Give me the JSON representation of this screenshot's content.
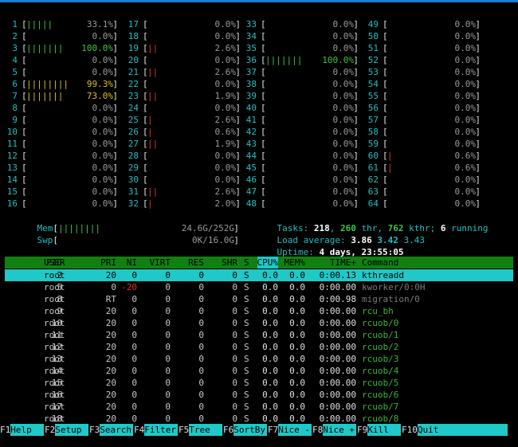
{
  "cpus": [
    {
      "n": "1",
      "pct": "33.1%",
      "bars": "|||||",
      "color": "g"
    },
    {
      "n": "2",
      "pct": "0.0%",
      "bars": "",
      "color": "g"
    },
    {
      "n": "3",
      "pct": "100.0%",
      "bars": "|||||||",
      "color": "g"
    },
    {
      "n": "4",
      "pct": "0.0%",
      "bars": "",
      "color": "g"
    },
    {
      "n": "5",
      "pct": "0.0%",
      "bars": "",
      "color": "g"
    },
    {
      "n": "6",
      "pct": "99.3%",
      "bars": "||||||||",
      "color": "y"
    },
    {
      "n": "7",
      "pct": "73.0%",
      "bars": "|||||||",
      "color": "y"
    },
    {
      "n": "8",
      "pct": "0.0%",
      "bars": "",
      "color": "g"
    },
    {
      "n": "9",
      "pct": "0.0%",
      "bars": "",
      "color": "g"
    },
    {
      "n": "10",
      "pct": "0.0%",
      "bars": "",
      "color": "g"
    },
    {
      "n": "11",
      "pct": "0.0%",
      "bars": "",
      "color": "g"
    },
    {
      "n": "12",
      "pct": "0.0%",
      "bars": "",
      "color": "g"
    },
    {
      "n": "13",
      "pct": "0.0%",
      "bars": "",
      "color": "g"
    },
    {
      "n": "14",
      "pct": "0.0%",
      "bars": "",
      "color": "g"
    },
    {
      "n": "15",
      "pct": "0.0%",
      "bars": "",
      "color": "g"
    },
    {
      "n": "16",
      "pct": "0.0%",
      "bars": "",
      "color": "g"
    },
    {
      "n": "17",
      "pct": "0.0%",
      "bars": "",
      "color": "g"
    },
    {
      "n": "18",
      "pct": "0.0%",
      "bars": "",
      "color": "g"
    },
    {
      "n": "19",
      "pct": "2.6%",
      "bars": "||",
      "color": "r"
    },
    {
      "n": "20",
      "pct": "0.0%",
      "bars": "",
      "color": "g"
    },
    {
      "n": "21",
      "pct": "2.6%",
      "bars": "||",
      "color": "r"
    },
    {
      "n": "22",
      "pct": "0.0%",
      "bars": "",
      "color": "g"
    },
    {
      "n": "23",
      "pct": "1.9%",
      "bars": "||",
      "color": "r"
    },
    {
      "n": "24",
      "pct": "0.0%",
      "bars": "",
      "color": "g"
    },
    {
      "n": "25",
      "pct": "2.6%",
      "bars": "|",
      "color": "r"
    },
    {
      "n": "26",
      "pct": "0.6%",
      "bars": "|",
      "color": "r"
    },
    {
      "n": "27",
      "pct": "1.9%",
      "bars": "||",
      "color": "r"
    },
    {
      "n": "28",
      "pct": "0.0%",
      "bars": "",
      "color": "g"
    },
    {
      "n": "29",
      "pct": "0.0%",
      "bars": "",
      "color": "g"
    },
    {
      "n": "30",
      "pct": "0.0%",
      "bars": "",
      "color": "g"
    },
    {
      "n": "31",
      "pct": "2.6%",
      "bars": "||",
      "color": "r"
    },
    {
      "n": "32",
      "pct": "2.0%",
      "bars": "|",
      "color": "r"
    },
    {
      "n": "33",
      "pct": "0.0%",
      "bars": "",
      "color": "g"
    },
    {
      "n": "34",
      "pct": "0.0%",
      "bars": "",
      "color": "g"
    },
    {
      "n": "35",
      "pct": "0.0%",
      "bars": "",
      "color": "g"
    },
    {
      "n": "36",
      "pct": "100.0%",
      "bars": "|||||||",
      "color": "g"
    },
    {
      "n": "37",
      "pct": "0.0%",
      "bars": "",
      "color": "g"
    },
    {
      "n": "38",
      "pct": "0.0%",
      "bars": "",
      "color": "g"
    },
    {
      "n": "39",
      "pct": "0.0%",
      "bars": "",
      "color": "g"
    },
    {
      "n": "40",
      "pct": "0.0%",
      "bars": "",
      "color": "g"
    },
    {
      "n": "41",
      "pct": "0.0%",
      "bars": "",
      "color": "g"
    },
    {
      "n": "42",
      "pct": "0.0%",
      "bars": "",
      "color": "g"
    },
    {
      "n": "43",
      "pct": "0.0%",
      "bars": "",
      "color": "g"
    },
    {
      "n": "44",
      "pct": "0.0%",
      "bars": "",
      "color": "g"
    },
    {
      "n": "45",
      "pct": "0.0%",
      "bars": "",
      "color": "g"
    },
    {
      "n": "46",
      "pct": "0.0%",
      "bars": "",
      "color": "g"
    },
    {
      "n": "47",
      "pct": "0.0%",
      "bars": "",
      "color": "g"
    },
    {
      "n": "48",
      "pct": "0.0%",
      "bars": "",
      "color": "g"
    },
    {
      "n": "49",
      "pct": "0.0%",
      "bars": "",
      "color": "g"
    },
    {
      "n": "50",
      "pct": "0.0%",
      "bars": "",
      "color": "g"
    },
    {
      "n": "51",
      "pct": "0.0%",
      "bars": "",
      "color": "g"
    },
    {
      "n": "52",
      "pct": "0.0%",
      "bars": "",
      "color": "g"
    },
    {
      "n": "53",
      "pct": "0.0%",
      "bars": "",
      "color": "g"
    },
    {
      "n": "54",
      "pct": "0.0%",
      "bars": "",
      "color": "g"
    },
    {
      "n": "55",
      "pct": "0.0%",
      "bars": "",
      "color": "g"
    },
    {
      "n": "56",
      "pct": "0.0%",
      "bars": "",
      "color": "g"
    },
    {
      "n": "57",
      "pct": "0.0%",
      "bars": "",
      "color": "g"
    },
    {
      "n": "58",
      "pct": "0.0%",
      "bars": "",
      "color": "g"
    },
    {
      "n": "59",
      "pct": "0.0%",
      "bars": "",
      "color": "g"
    },
    {
      "n": "60",
      "pct": "0.6%",
      "bars": "|",
      "color": "r"
    },
    {
      "n": "61",
      "pct": "0.6%",
      "bars": "|",
      "color": "r"
    },
    {
      "n": "62",
      "pct": "0.0%",
      "bars": "",
      "color": "g"
    },
    {
      "n": "63",
      "pct": "0.0%",
      "bars": "",
      "color": "g"
    },
    {
      "n": "64",
      "pct": "0.0%",
      "bars": "",
      "color": "g"
    }
  ],
  "memory": {
    "mem_label": "Mem",
    "mem_bars": "||||||||",
    "mem_value": "24.6G/252G",
    "swp_label": "Swp",
    "swp_value": "0K/16.0G"
  },
  "tasks": {
    "label": "Tasks:",
    "count": "218",
    "thr": "260",
    "thr_label": "thr,",
    "kthr": "762",
    "kthr_label": "kthr;",
    "running": "6",
    "running_label": "running",
    "load_label": "Load average:",
    "load1": "3.86",
    "load5": "3.42",
    "load15": "3.43",
    "uptime_label": "Uptime:",
    "uptime": "4 days, 23:55:05"
  },
  "columns": [
    "PID",
    "USER",
    "PRI",
    "NI",
    "VIRT",
    "RES",
    "SHR",
    "S",
    "CPU%",
    "MEM%",
    "TIME+",
    "Command"
  ],
  "processes": [
    {
      "pid": "2",
      "user": "root",
      "pri": "20",
      "ni": "0",
      "virt": "0",
      "res": "0",
      "shr": "0",
      "s": "S",
      "cpu": "0.0",
      "mem": "0.0",
      "time": "0:00.13",
      "cmd": "kthreadd"
    },
    {
      "pid": "5",
      "user": "root",
      "pri": "0",
      "ni": "-20",
      "virt": "0",
      "res": "0",
      "shr": "0",
      "s": "S",
      "cpu": "0.0",
      "mem": "0.0",
      "time": "0:00.00",
      "cmd": "kworker/0:0H"
    },
    {
      "pid": "8",
      "user": "root",
      "pri": "RT",
      "ni": "0",
      "virt": "0",
      "res": "0",
      "shr": "0",
      "s": "S",
      "cpu": "0.0",
      "mem": "0.0",
      "time": "0:00.98",
      "cmd": "migration/0"
    },
    {
      "pid": "9",
      "user": "root",
      "pri": "20",
      "ni": "0",
      "virt": "0",
      "res": "0",
      "shr": "0",
      "s": "S",
      "cpu": "0.0",
      "mem": "0.0",
      "time": "0:00.00",
      "cmd": "rcu_bh"
    },
    {
      "pid": "10",
      "user": "root",
      "pri": "20",
      "ni": "0",
      "virt": "0",
      "res": "0",
      "shr": "0",
      "s": "S",
      "cpu": "0.0",
      "mem": "0.0",
      "time": "0:00.00",
      "cmd": "rcuob/0"
    },
    {
      "pid": "11",
      "user": "root",
      "pri": "20",
      "ni": "0",
      "virt": "0",
      "res": "0",
      "shr": "0",
      "s": "S",
      "cpu": "0.0",
      "mem": "0.0",
      "time": "0:00.00",
      "cmd": "rcuob/1"
    },
    {
      "pid": "12",
      "user": "root",
      "pri": "20",
      "ni": "0",
      "virt": "0",
      "res": "0",
      "shr": "0",
      "s": "S",
      "cpu": "0.0",
      "mem": "0.0",
      "time": "0:00.00",
      "cmd": "rcuob/2"
    },
    {
      "pid": "13",
      "user": "root",
      "pri": "20",
      "ni": "0",
      "virt": "0",
      "res": "0",
      "shr": "0",
      "s": "S",
      "cpu": "0.0",
      "mem": "0.0",
      "time": "0:00.00",
      "cmd": "rcuob/3"
    },
    {
      "pid": "14",
      "user": "root",
      "pri": "20",
      "ni": "0",
      "virt": "0",
      "res": "0",
      "shr": "0",
      "s": "S",
      "cpu": "0.0",
      "mem": "0.0",
      "time": "0:00.00",
      "cmd": "rcuob/4"
    },
    {
      "pid": "15",
      "user": "root",
      "pri": "20",
      "ni": "0",
      "virt": "0",
      "res": "0",
      "shr": "0",
      "s": "S",
      "cpu": "0.0",
      "mem": "0.0",
      "time": "0:00.00",
      "cmd": "rcuob/5"
    },
    {
      "pid": "16",
      "user": "root",
      "pri": "20",
      "ni": "0",
      "virt": "0",
      "res": "0",
      "shr": "0",
      "s": "S",
      "cpu": "0.0",
      "mem": "0.0",
      "time": "0:00.00",
      "cmd": "rcuob/6"
    },
    {
      "pid": "17",
      "user": "root",
      "pri": "20",
      "ni": "0",
      "virt": "0",
      "res": "0",
      "shr": "0",
      "s": "S",
      "cpu": "0.0",
      "mem": "0.0",
      "time": "0:00.00",
      "cmd": "rcuob/7"
    },
    {
      "pid": "18",
      "user": "root",
      "pri": "20",
      "ni": "0",
      "virt": "0",
      "res": "0",
      "shr": "0",
      "s": "S",
      "cpu": "0.0",
      "mem": "0.0",
      "time": "0:00.00",
      "cmd": "rcuob/8"
    }
  ],
  "footer": [
    {
      "key": "F1",
      "label": "Help"
    },
    {
      "key": "F2",
      "label": "Setup"
    },
    {
      "key": "F3",
      "label": "Search"
    },
    {
      "key": "F4",
      "label": "Filter"
    },
    {
      "key": "F5",
      "label": "Tree"
    },
    {
      "key": "F6",
      "label": "SortBy"
    },
    {
      "key": "F7",
      "label": "Nice -"
    },
    {
      "key": "F8",
      "label": "Nice +"
    },
    {
      "key": "F9",
      "label": "Kill"
    },
    {
      "key": "F10",
      "label": "Quit"
    }
  ],
  "colors": {
    "cyan": "#20c8c8",
    "green": "#3cc83c",
    "red": "#e03030",
    "yellow": "#e0c020",
    "header_green": "#118011"
  }
}
